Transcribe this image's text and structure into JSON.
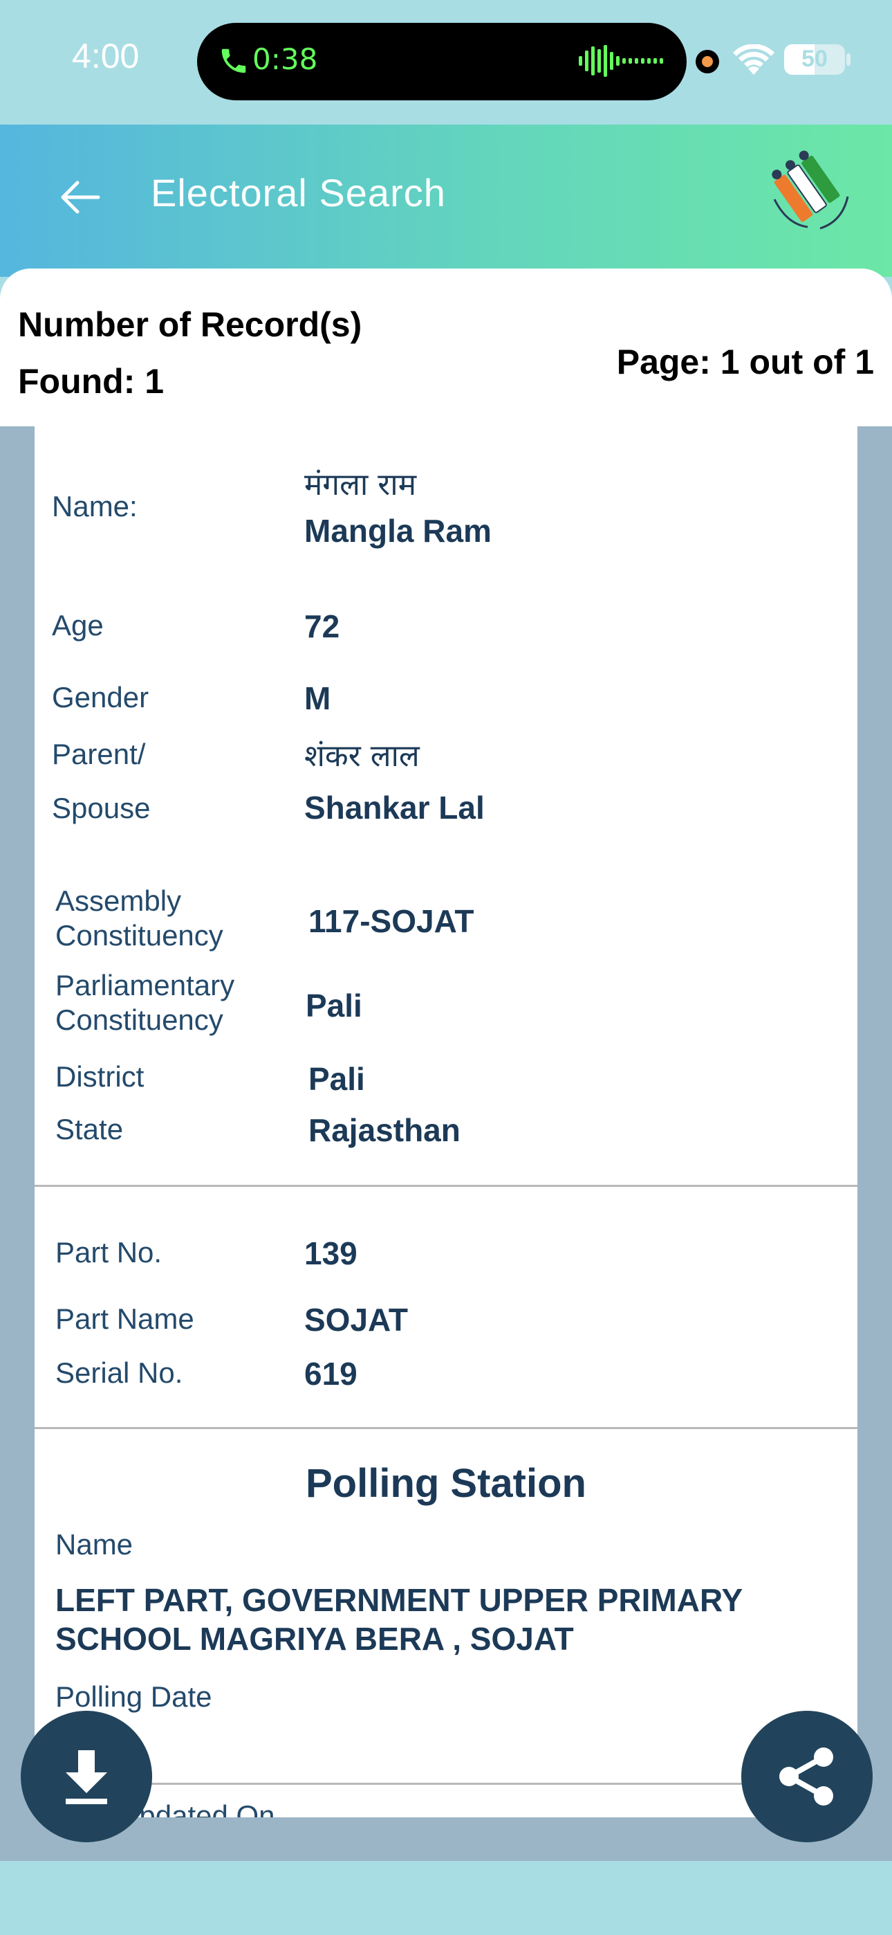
{
  "status_bar": {
    "time": "4:00",
    "call_duration": "0:38",
    "battery": "50",
    "icons": [
      "phone-icon",
      "audio-wave-icon",
      "camera-dot-icon",
      "wifi-icon",
      "battery-icon"
    ]
  },
  "header": {
    "title": "Electoral Search",
    "back_icon": "arrow-left-icon",
    "logo": "eci-logo"
  },
  "records": {
    "count_line1": "Number of Record(s)",
    "count_line2": "Found: 1",
    "page": "Page: 1 out of 1"
  },
  "voter": {
    "name_label": "Name:",
    "name_hindi": "मंगला राम",
    "name": "Mangla Ram",
    "age_label": "Age",
    "age": "72",
    "gender_label": "Gender",
    "gender": "M",
    "parent_label_1": "Parent/",
    "parent_label_2": "Spouse",
    "parent_hindi": "शंकर लाल",
    "parent": "Shankar Lal",
    "assembly_label_1": "Assembly",
    "assembly_label_2": "Constituency",
    "assembly": "117-SOJAT",
    "parliamentary_label_1": "Parliamentary",
    "parliamentary_label_2": "Constituency",
    "parliamentary": "Pali",
    "district_label": "District",
    "district": "Pali",
    "state_label": "State",
    "state": "Rajasthan"
  },
  "part": {
    "part_no_label": "Part No.",
    "part_no": "139",
    "part_name_label": "Part Name",
    "part_name": "SOJAT",
    "serial_label": "Serial No.",
    "serial": "619"
  },
  "polling_station": {
    "title": "Polling Station",
    "name_label": "Name",
    "name": "LEFT PART, GOVERNMENT UPPER PRIMARY SCHOOL MAGRIYA BERA , SOJAT",
    "date_label": "Polling Date",
    "updated_label": "Last Updated On"
  },
  "actions": {
    "download_icon": "download-icon",
    "share_icon": "share-icon"
  },
  "colors": {
    "header_gradient_start": "#55b6de",
    "header_gradient_end": "#6ce7a6",
    "text_primary": "#1c3a57",
    "fab": "#21445c",
    "backdrop": "#9bb5c6"
  }
}
